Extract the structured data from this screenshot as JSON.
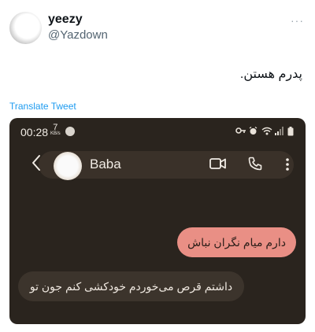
{
  "tweet": {
    "display_name": "yeezy",
    "handle": "@Yazdown",
    "more_label": "···",
    "text": "پدرم هستن.",
    "translate_label": "Translate Tweet"
  },
  "screenshot": {
    "status_bar": {
      "time": "00:28",
      "speed_value": "7",
      "speed_unit": "KB/s"
    },
    "chat_header": {
      "contact_name": "Baba"
    },
    "messages": [
      {
        "direction": "outgoing",
        "text": "دارم میام نگران نباش"
      },
      {
        "direction": "incoming",
        "text": "داشتم قرص می‌خوردم خودکشی کنم جون تو"
      }
    ]
  },
  "icons": {
    "back": "chevron-left-icon",
    "video": "video-camera-icon",
    "call": "phone-icon",
    "menu": "kebab-menu-icon"
  },
  "colors": {
    "phone_background": "#2a241e",
    "outgoing_bubble": "#e98f85",
    "incoming_bubble": "#3c342c",
    "link": "#1d9bf0"
  }
}
